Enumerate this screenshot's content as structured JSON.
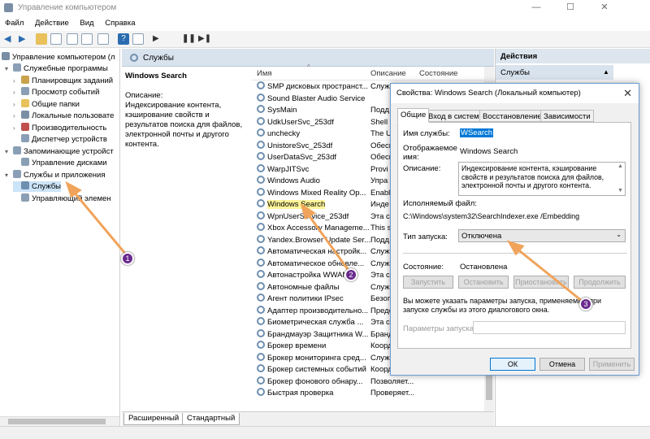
{
  "window": {
    "title": "Управление компьютером"
  },
  "menu": [
    "Файл",
    "Действие",
    "Вид",
    "Справка"
  ],
  "tree": {
    "root": "Управление компьютером (л",
    "items": [
      {
        "label": "Служебные программы",
        "indent": 1
      },
      {
        "label": "Планировщик заданий",
        "indent": 2
      },
      {
        "label": "Просмотр событий",
        "indent": 2
      },
      {
        "label": "Общие папки",
        "indent": 2
      },
      {
        "label": "Локальные пользовате",
        "indent": 2
      },
      {
        "label": "Производительность",
        "indent": 2
      },
      {
        "label": "Диспетчер устройств",
        "indent": 2
      },
      {
        "label": "Запоминающие устройст",
        "indent": 1
      },
      {
        "label": "Управление дисками",
        "indent": 2
      },
      {
        "label": "Службы и приложения",
        "indent": 1
      },
      {
        "label": "Службы",
        "indent": 2
      },
      {
        "label": "Управляющий элемен",
        "indent": 2
      }
    ]
  },
  "services_panel": {
    "header": "Службы",
    "selected_name": "Windows Search",
    "desc_label": "Описание:",
    "desc_text": "Индексирование контента, кэширование свойств и результатов поиска для файлов, электронной почты и другого контента.",
    "columns": [
      "Имя",
      "Описание",
      "Состояние"
    ],
    "rows": [
      {
        "name": "SMP дисковых пространст...",
        "desc": "Служ"
      },
      {
        "name": "Sound Blaster Audio Service",
        "desc": ""
      },
      {
        "name": "SysMain",
        "desc": "Подд"
      },
      {
        "name": "UdkUserSvc_253df",
        "desc": "Shell"
      },
      {
        "name": "unchecky",
        "desc": "The U"
      },
      {
        "name": "UnistoreSvc_253df",
        "desc": "Обесп"
      },
      {
        "name": "UserDataSvc_253df",
        "desc": "Обесп"
      },
      {
        "name": "WarpJITSvc",
        "desc": "Provi"
      },
      {
        "name": "Windows Audio",
        "desc": "Упра"
      },
      {
        "name": "Windows Mixed Reality Op...",
        "desc": "Enabl"
      },
      {
        "name": "Windows Search",
        "desc": "Инде"
      },
      {
        "name": "WpnUserService_253df",
        "desc": "Эта сл"
      },
      {
        "name": "Xbox Accessory Manageme...",
        "desc": "This s"
      },
      {
        "name": "Yandex.Browser Update Ser...",
        "desc": "Подд"
      },
      {
        "name": "Автоматическая настройк...",
        "desc": "Служ"
      },
      {
        "name": "Автоматическое обновле...",
        "desc": "Служ"
      },
      {
        "name": "Автонастройка WWAN",
        "desc": "Эта сл"
      },
      {
        "name": "Автономные файлы",
        "desc": "Служ"
      },
      {
        "name": "Агент политики IPsec",
        "desc": "Безоп"
      },
      {
        "name": "Адаптер производительно...",
        "desc": "Предо"
      },
      {
        "name": "Биометрическая служба ...",
        "desc": "Эта сл"
      },
      {
        "name": "Брандмауэр Защитника W...",
        "desc": "Бранд"
      },
      {
        "name": "Брокер времени",
        "desc": "Коорд"
      },
      {
        "name": "Брокер мониторинга сред...",
        "desc": "Служ"
      },
      {
        "name": "Брокер системных событий",
        "desc": "Коорд"
      },
      {
        "name": "Брокер фонового обнару...",
        "desc": "Позволяет..."
      },
      {
        "name": "Быстрая проверка",
        "desc": "Проверяет..."
      }
    ],
    "tabs": [
      "Расширенный",
      "Стандартный"
    ]
  },
  "actions": {
    "header": "Действия",
    "sub": "Службы"
  },
  "dialog": {
    "title": "Свойства: Windows Search (Локальный компьютер)",
    "tabs": [
      "Общие",
      "Вход в систему",
      "Восстановление",
      "Зависимости"
    ],
    "service_name_label": "Имя службы:",
    "service_name": "WSearch",
    "display_name_label": "Отображаемое имя:",
    "display_name": "Windows Search",
    "description_label": "Описание:",
    "description": "Индексирование контента, кэширование свойств и результатов поиска для файлов, электронной почты и другого контента.",
    "exe_label": "Исполняемый файл:",
    "exe_path": "C:\\Windows\\system32\\SearchIndexer.exe /Embedding",
    "startup_label": "Тип запуска:",
    "startup_value": "Отключена",
    "status_label": "Состояние:",
    "status_value": "Остановлена",
    "buttons": [
      "Запустить",
      "Остановить",
      "Приостановить",
      "Продолжить"
    ],
    "hint": "Вы можете указать параметры запуска, применяемые при запуске службы из этого диалогового окна.",
    "params_label": "Параметры запуска:",
    "ok": "ОК",
    "cancel": "Отмена",
    "apply": "Применить"
  },
  "annotations": [
    "1",
    "2",
    "3"
  ],
  "colors": {
    "arrow": "#f0a35a",
    "badge": "#6a2a8e",
    "highlight": "#fff59a",
    "selection": "#cce4f7"
  }
}
